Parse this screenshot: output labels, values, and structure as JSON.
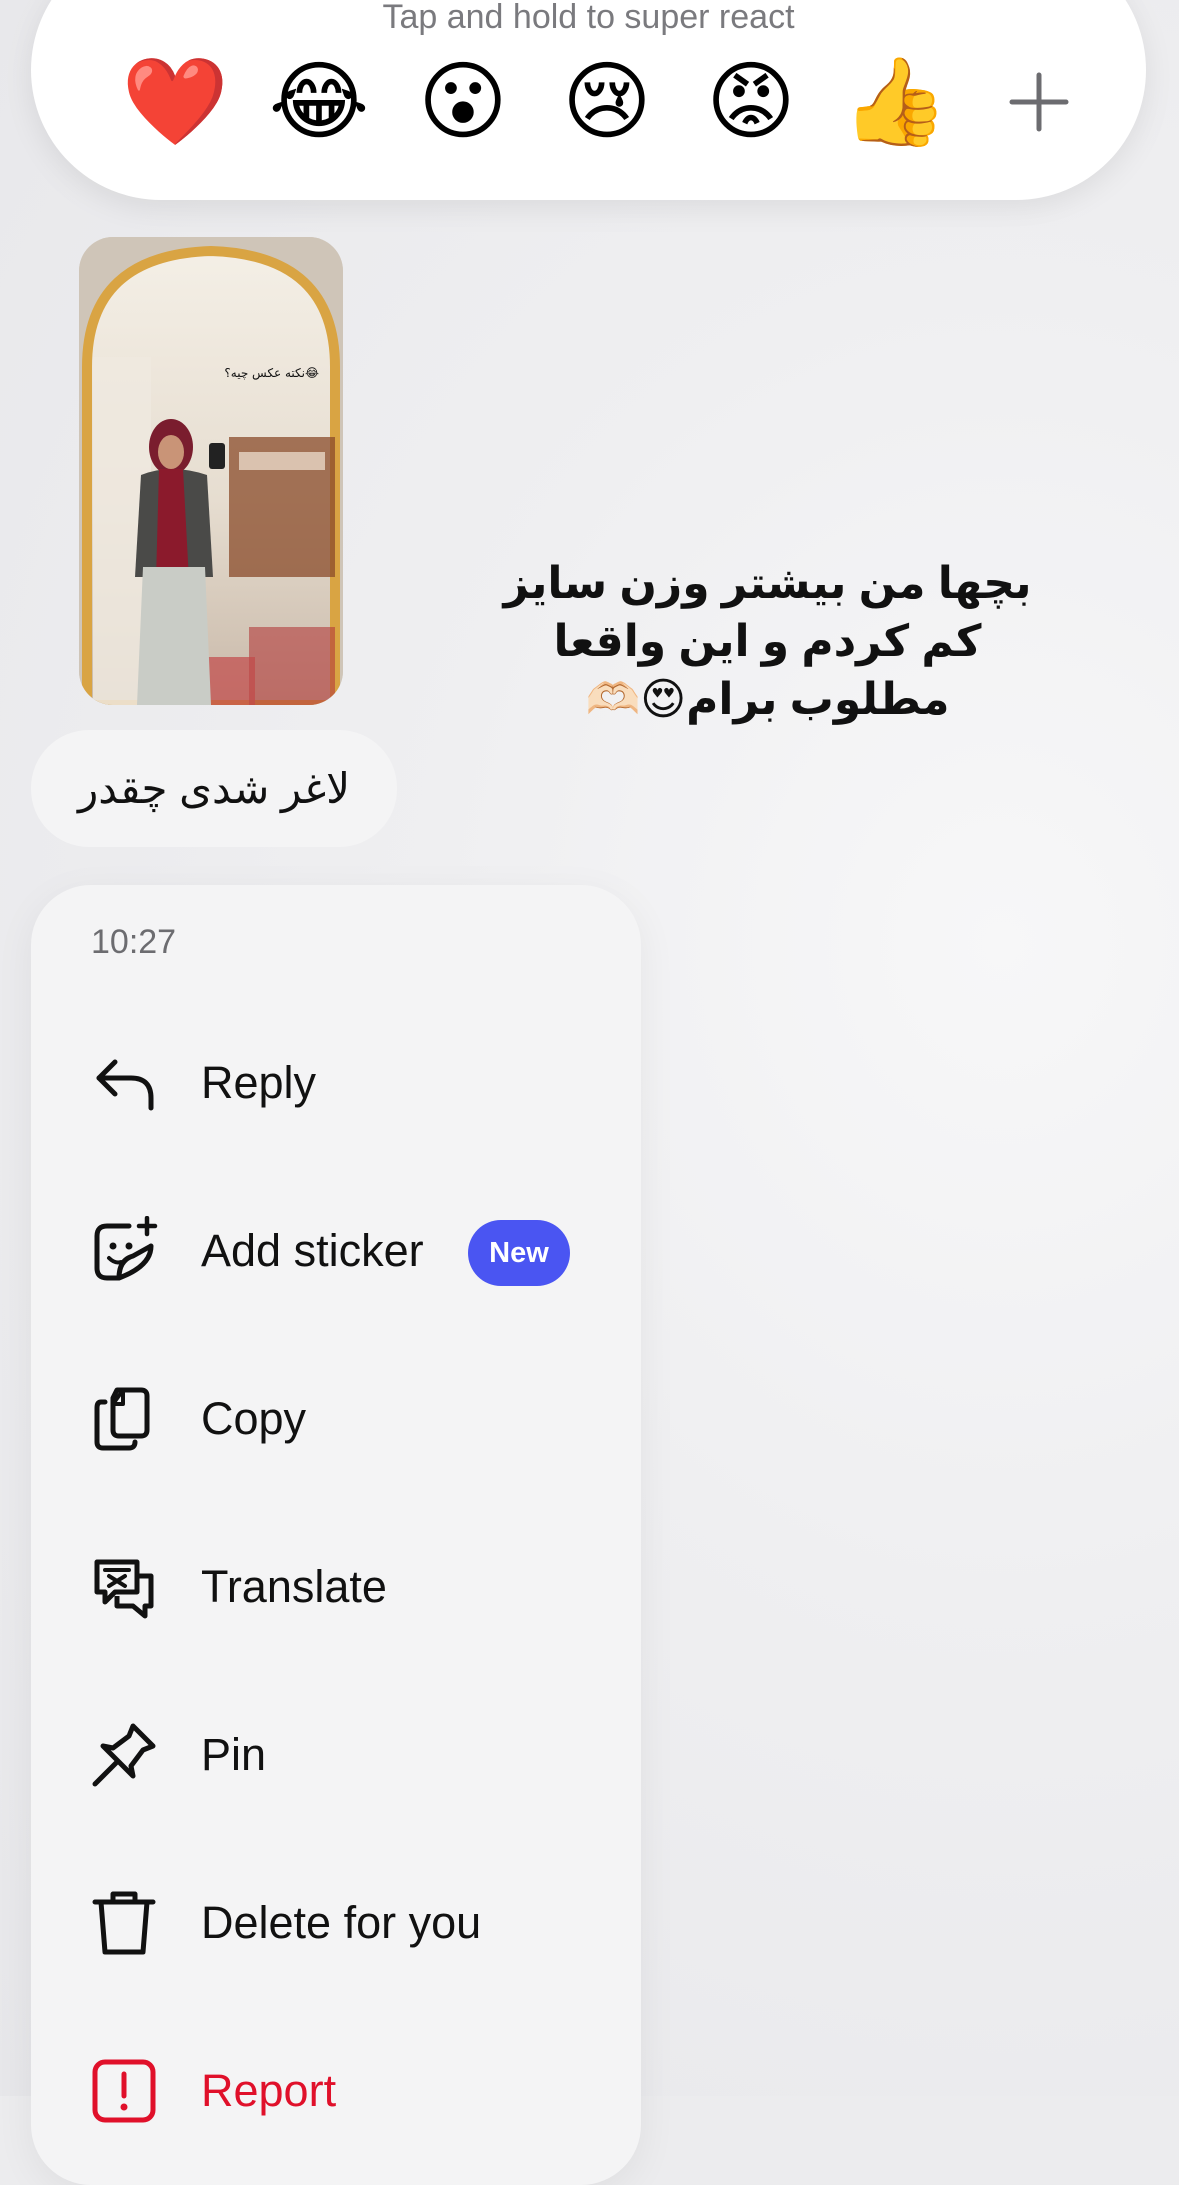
{
  "reaction_bar": {
    "hint": "Tap and hold to super react",
    "emojis": [
      "❤️",
      "😂",
      "😮",
      "😢",
      "😡",
      "👍"
    ],
    "more_icon": "plus-icon"
  },
  "post": {
    "image_overlay_text": "نکته عکس چیه؟😂",
    "caption": "بچها من بیشتر وزن سایز کم کردم و این واقعا مطلوب برام😍🫶🏻"
  },
  "message": {
    "text": "لاغر شدی چقدر"
  },
  "menu": {
    "time": "10:27",
    "items": [
      {
        "label": "Reply",
        "icon": "reply-icon"
      },
      {
        "label": "Add sticker",
        "icon": "sticker-icon",
        "badge": "New"
      },
      {
        "label": "Copy",
        "icon": "copy-icon"
      },
      {
        "label": "Translate",
        "icon": "translate-icon"
      },
      {
        "label": "Pin",
        "icon": "pin-icon"
      },
      {
        "label": "Delete for you",
        "icon": "trash-icon"
      },
      {
        "label": "Report",
        "icon": "report-icon"
      }
    ],
    "accent_color": "#4a55f2",
    "danger_color": "#e0102a"
  }
}
